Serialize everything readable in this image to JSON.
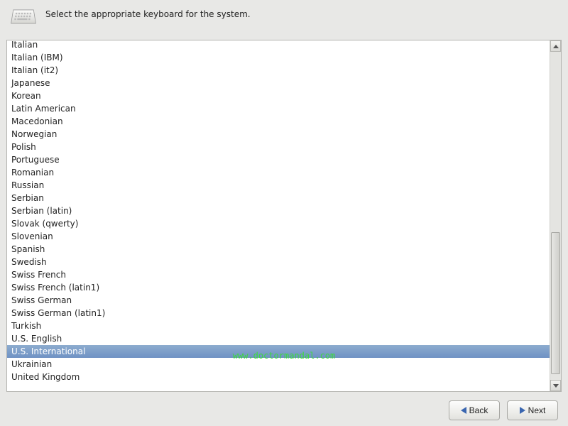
{
  "header": {
    "instruction": "Select the appropriate keyboard for the system."
  },
  "keyboards": {
    "selected": "U.S. International",
    "items": [
      "Italian",
      "Italian (IBM)",
      "Italian (it2)",
      "Japanese",
      "Korean",
      "Latin American",
      "Macedonian",
      "Norwegian",
      "Polish",
      "Portuguese",
      "Romanian",
      "Russian",
      "Serbian",
      "Serbian (latin)",
      "Slovak (qwerty)",
      "Slovenian",
      "Spanish",
      "Swedish",
      "Swiss French",
      "Swiss French (latin1)",
      "Swiss German",
      "Swiss German (latin1)",
      "Turkish",
      "U.S. English",
      "U.S. International",
      "Ukrainian",
      "United Kingdom"
    ]
  },
  "footer": {
    "back_label": "Back",
    "next_label": "Next"
  },
  "watermark": "www.doctormandal.com"
}
